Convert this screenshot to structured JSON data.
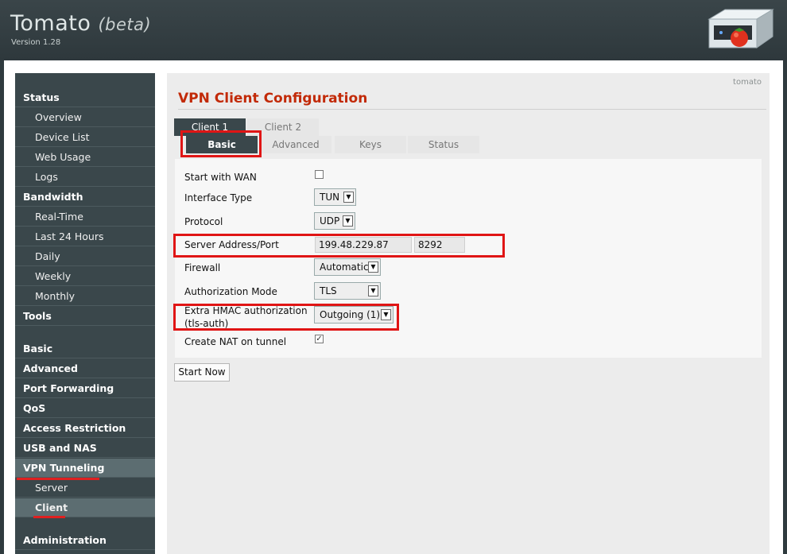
{
  "app": {
    "title": "Tomato",
    "beta": "(beta)",
    "version": "Version 1.28",
    "router_name": "tomato"
  },
  "sidebar": {
    "items": [
      {
        "label": "Status",
        "type": "head"
      },
      {
        "label": "Overview",
        "type": "sub"
      },
      {
        "label": "Device List",
        "type": "sub"
      },
      {
        "label": "Web Usage",
        "type": "sub"
      },
      {
        "label": "Logs",
        "type": "sub"
      },
      {
        "label": "Bandwidth",
        "type": "head"
      },
      {
        "label": "Real-Time",
        "type": "sub"
      },
      {
        "label": "Last 24 Hours",
        "type": "sub"
      },
      {
        "label": "Daily",
        "type": "sub"
      },
      {
        "label": "Weekly",
        "type": "sub"
      },
      {
        "label": "Monthly",
        "type": "sub"
      },
      {
        "label": "Tools",
        "type": "head"
      },
      {
        "label": "Basic",
        "type": "head"
      },
      {
        "label": "Advanced",
        "type": "head"
      },
      {
        "label": "Port Forwarding",
        "type": "head"
      },
      {
        "label": "QoS",
        "type": "head"
      },
      {
        "label": "Access Restriction",
        "type": "head"
      },
      {
        "label": "USB and NAS",
        "type": "head"
      },
      {
        "label": "VPN Tunneling",
        "type": "head",
        "active": true
      },
      {
        "label": "Server",
        "type": "sub"
      },
      {
        "label": "Client",
        "type": "sub",
        "active": true
      },
      {
        "label": "Administration",
        "type": "head"
      }
    ]
  },
  "main": {
    "title": "VPN Client Configuration",
    "client_tabs": [
      "Client 1",
      "Client 2"
    ],
    "sub_tabs": [
      "Basic",
      "Advanced",
      "Keys",
      "Status"
    ],
    "fields": {
      "start_with_wan": {
        "label": "Start with WAN",
        "checked": false
      },
      "interface_type": {
        "label": "Interface Type",
        "value": "TUN"
      },
      "protocol": {
        "label": "Protocol",
        "value": "UDP"
      },
      "server_address": {
        "label": "Server Address/Port",
        "address": "199.48.229.87",
        "port": "8292"
      },
      "firewall": {
        "label": "Firewall",
        "value": "Automatic"
      },
      "auth_mode": {
        "label": "Authorization Mode",
        "value": "TLS"
      },
      "hmac": {
        "label_line1": "Extra HMAC authorization",
        "label_line2": "(tls-auth)",
        "value": "Outgoing (1)"
      },
      "nat": {
        "label": "Create NAT on tunnel",
        "checked": true
      }
    },
    "start_button": "Start Now"
  },
  "colors": {
    "accent_title": "#c22a08",
    "highlight_red": "#e01515",
    "sidebar_bg": "#3a474b"
  }
}
